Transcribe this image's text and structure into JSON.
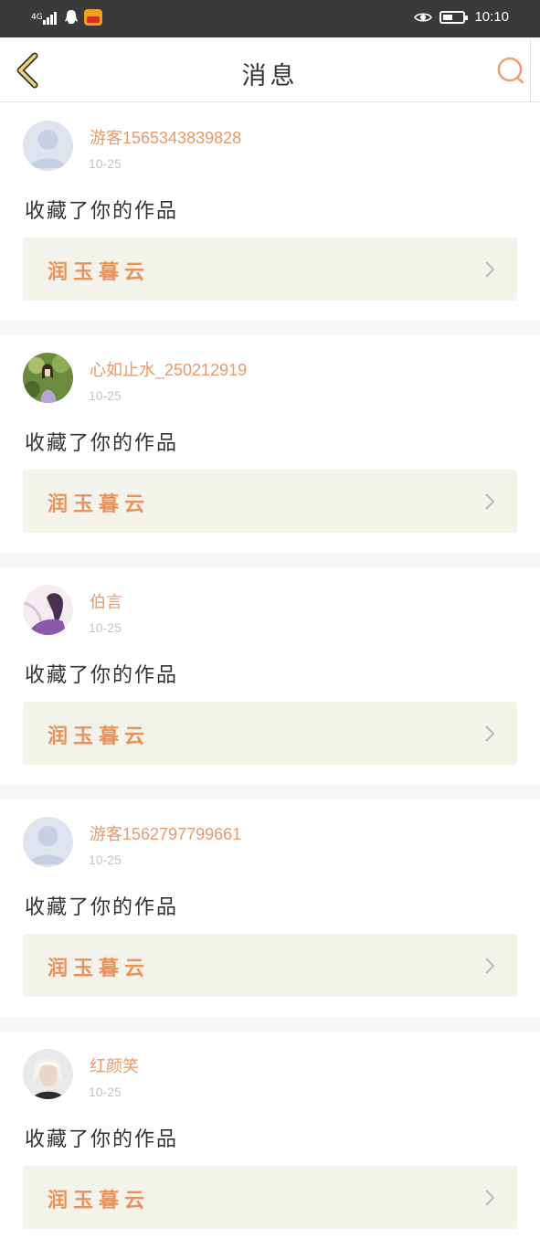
{
  "status_bar": {
    "network": "4G",
    "time": "10:10",
    "icons": [
      "signal-icon",
      "qq-icon",
      "app-notification-icon",
      "eye-comfort-icon",
      "battery-icon"
    ]
  },
  "header": {
    "title": "消息",
    "back_icon": "back-arrow-icon",
    "search_icon": "search-icon"
  },
  "colors": {
    "accent": "#e8935c",
    "username": "#e79a6a",
    "date": "#c4c4c4",
    "work_box_bg": "#f3f3ec",
    "back_arrow": "#f2d27a"
  },
  "messages": [
    {
      "avatar": "default-avatar",
      "username": "游客1565343839828",
      "date": "10-25",
      "action": "收藏了你的作品",
      "work_title": "润玉暮云"
    },
    {
      "avatar": "photo-avatar-girl-garden",
      "username": "心如止水_250212919",
      "date": "10-25",
      "action": "收藏了你的作品",
      "work_title": "润玉暮云"
    },
    {
      "avatar": "photo-avatar-purple",
      "username": "伯言",
      "date": "10-25",
      "action": "收藏了你的作品",
      "work_title": "润玉暮云"
    },
    {
      "avatar": "default-avatar",
      "username": "游客1562797799661",
      "date": "10-25",
      "action": "收藏了你的作品",
      "work_title": "润玉暮云"
    },
    {
      "avatar": "photo-avatar-white-hair",
      "username": "红颜笑",
      "date": "10-25",
      "action": "收藏了你的作品",
      "work_title": "润玉暮云"
    }
  ]
}
